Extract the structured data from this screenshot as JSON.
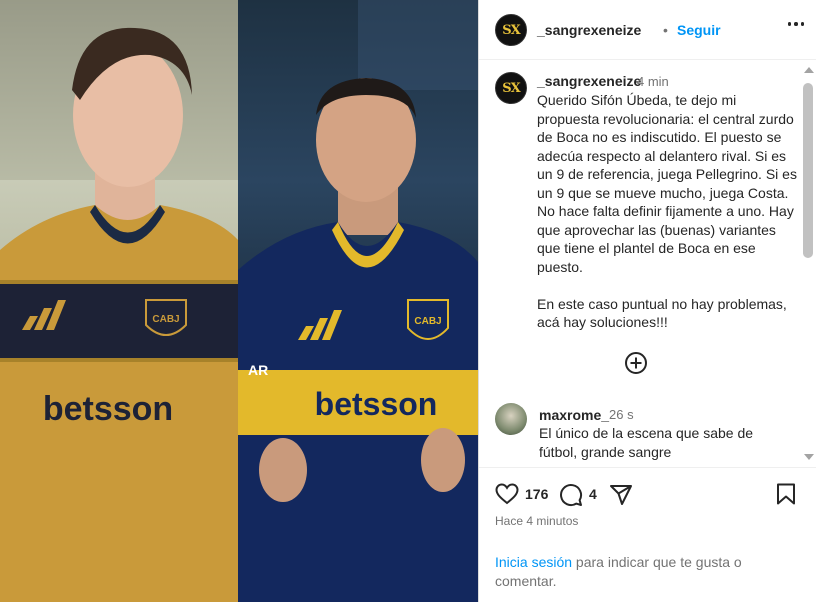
{
  "photo": {
    "left_shirt_sponsor": "betsson",
    "right_shirt_sponsor": "betsson",
    "crest_text": "CABJ",
    "right_shirt_number_fragment": "AR"
  },
  "header": {
    "avatar_text": "SX",
    "username": "_sangrexeneize",
    "dot": "•",
    "follow_label": "Seguir"
  },
  "caption": {
    "username": "_sangrexeneize",
    "time": "4 min",
    "text": "Querido Sifón Úbeda, te dejo mi propuesta revolucionaria: el central zurdo de Boca no es indiscutido. El puesto se adecúa respecto al delantero rival. Si es un 9 de referencia, juega Pellegrino. Si es un 9 que se mueve mucho, juega Costa. No hace falta definir fijamente a uno. Hay que aprovechar las (buenas) variantes que tiene el plantel de Boca en ese puesto.\n\nEn este caso puntual no hay problemas, acá hay soluciones!!!"
  },
  "comments": [
    {
      "username": "maxrome_",
      "time": "26 s",
      "text": "El único de la escena que sabe de fútbol, grande sangre"
    }
  ],
  "actions": {
    "likes": "176",
    "comments_count": "4"
  },
  "post_time": "Hace 4 minutos",
  "login": {
    "link": "Inicia sesión",
    "rest": " para indicar que te gusta o comentar."
  }
}
